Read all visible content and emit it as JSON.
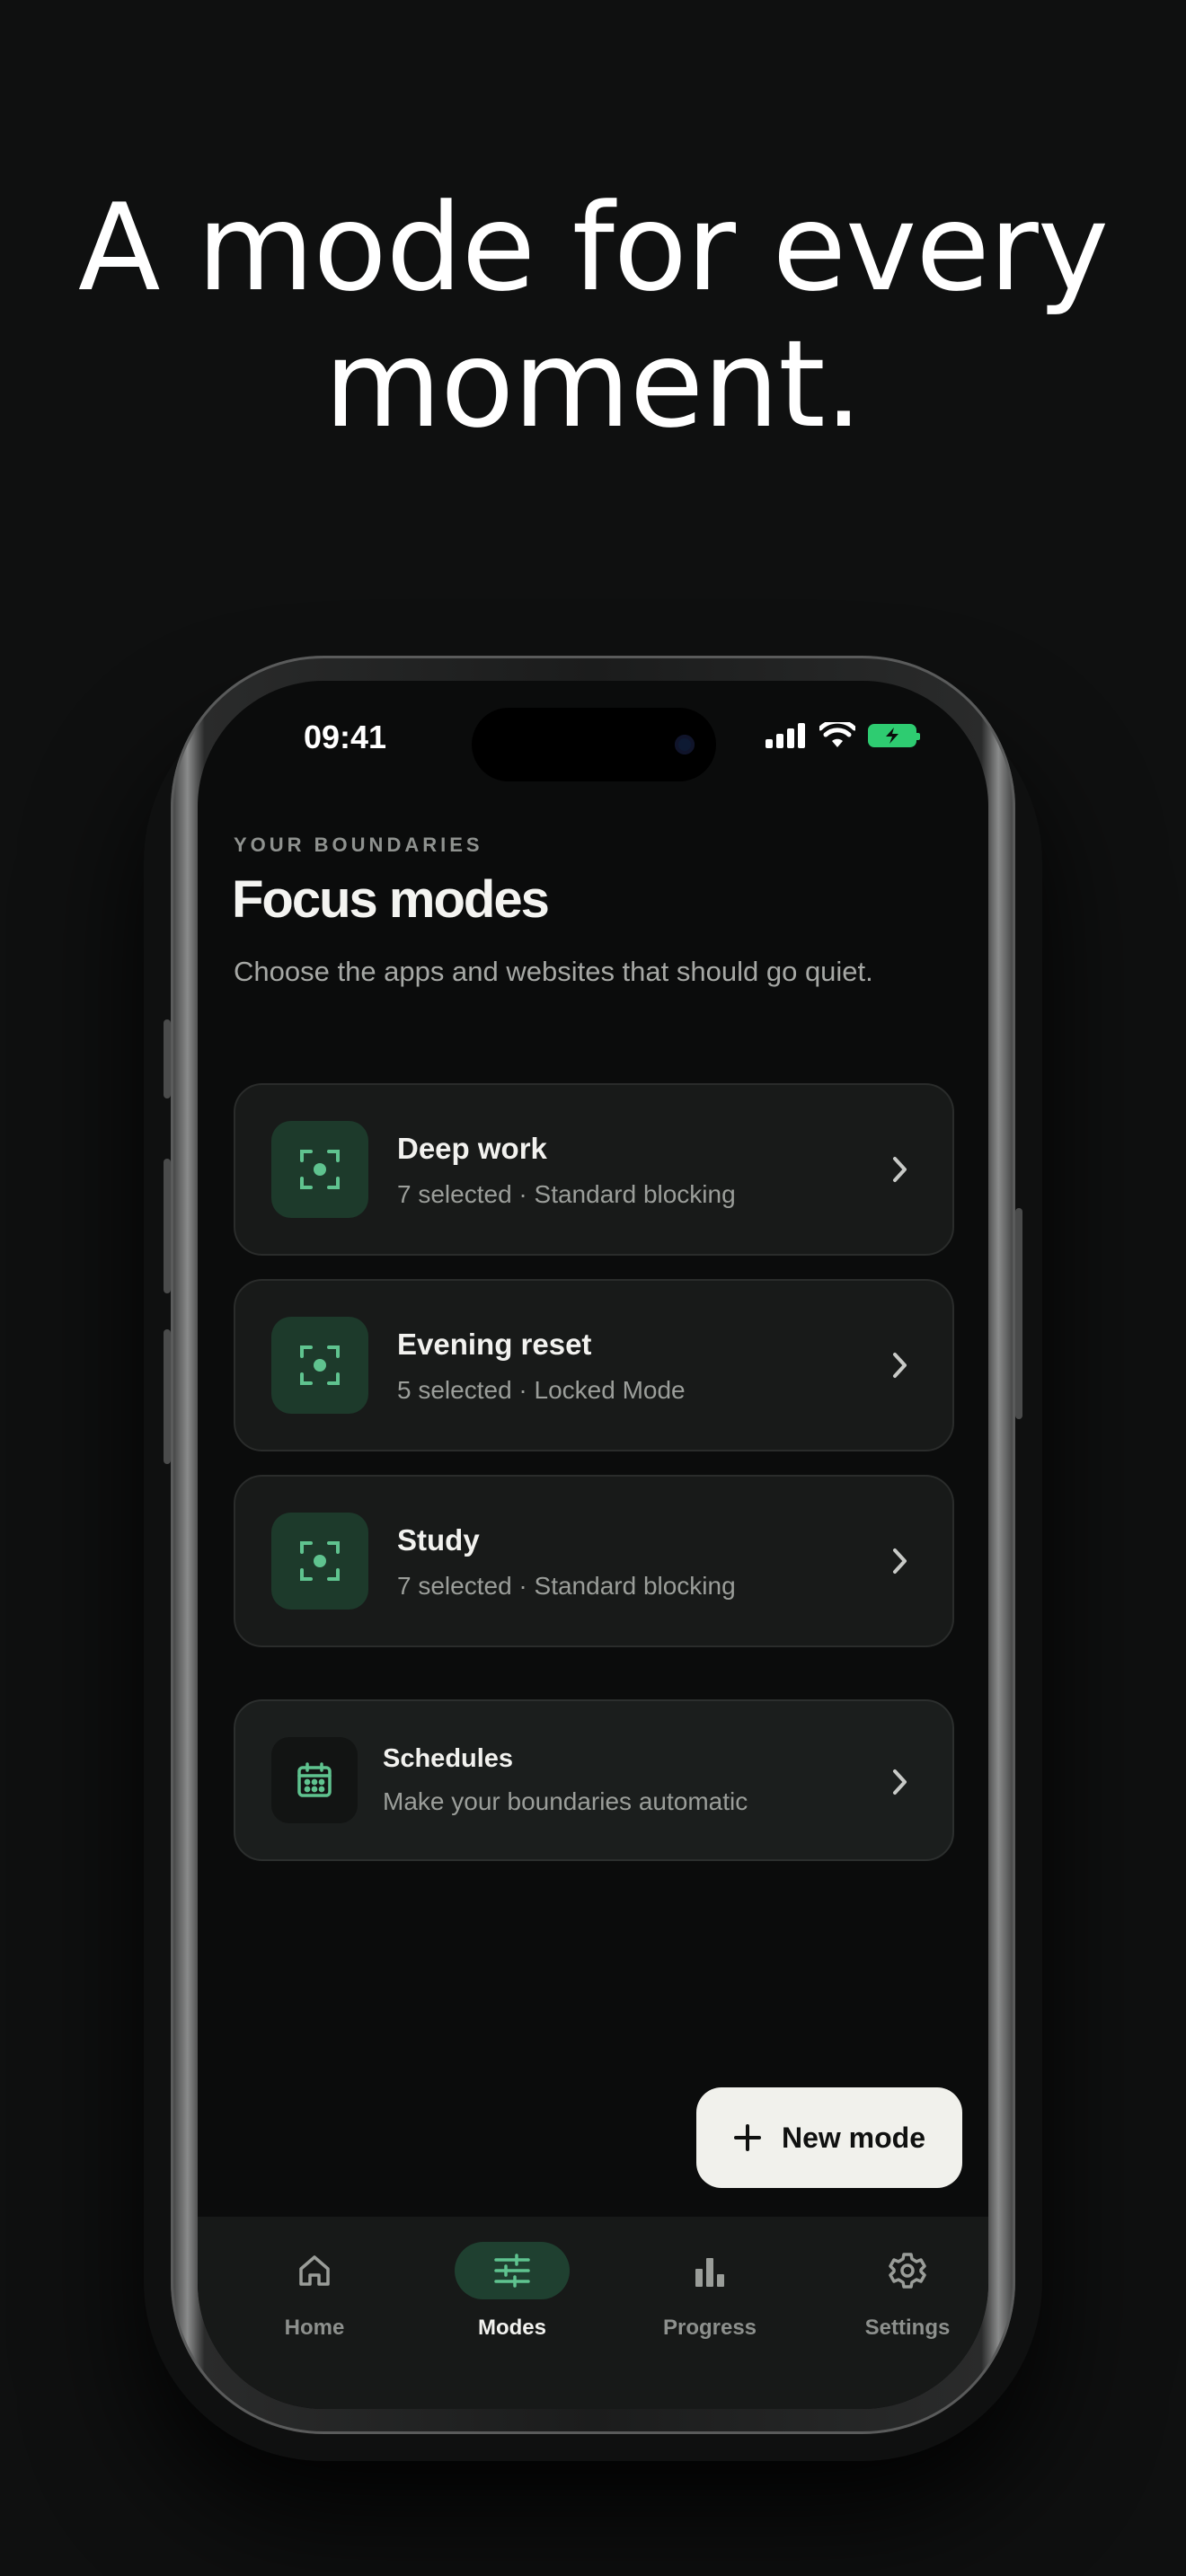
{
  "headline": {
    "line1": "A mode for every",
    "line2": "moment."
  },
  "status_bar": {
    "time": "09:41",
    "icons": [
      "signal-icon",
      "wifi-icon",
      "battery-charging-icon"
    ]
  },
  "header": {
    "eyebrow": "YOUR BOUNDARIES",
    "title": "Focus modes",
    "subtitle": "Choose the apps and websites that should go quiet."
  },
  "modes": [
    {
      "name": "Deep work",
      "meta": "7 selected · Standard blocking"
    },
    {
      "name": "Evening reset",
      "meta": "5 selected · Locked Mode"
    },
    {
      "name": "Study",
      "meta": "7 selected · Standard blocking"
    }
  ],
  "schedules": {
    "name": "Schedules",
    "meta": "Make your boundaries automatic"
  },
  "fab": {
    "label": "New mode"
  },
  "tabs": [
    {
      "label": "Home",
      "icon": "home-icon",
      "active": false
    },
    {
      "label": "Modes",
      "icon": "sliders-icon",
      "active": true
    },
    {
      "label": "Progress",
      "icon": "bar-chart-icon",
      "active": false
    },
    {
      "label": "Settings",
      "icon": "gear-icon",
      "active": false
    }
  ],
  "colors": {
    "accent": "#5fc38f",
    "accent_bg": "#1d3a2b",
    "background": "#0b0c0c"
  }
}
